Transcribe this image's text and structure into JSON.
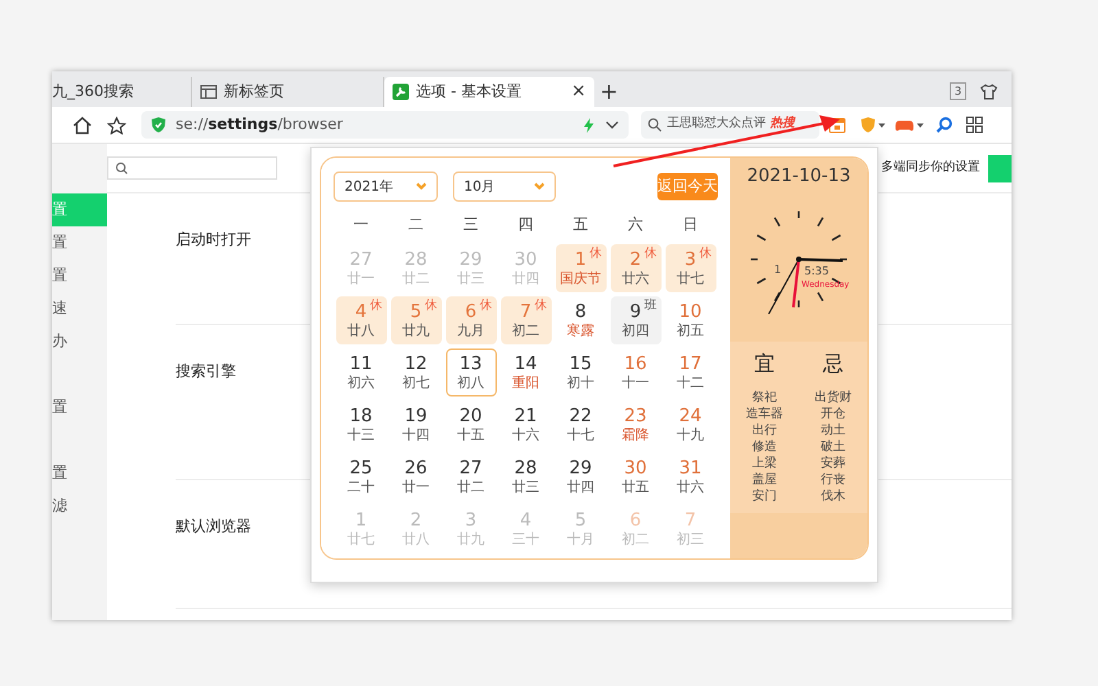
{
  "tabs": [
    {
      "label": "九_360搜索",
      "selected": false
    },
    {
      "label": "新标签页",
      "selected": false
    },
    {
      "label": "选项 - 基本设置",
      "selected": true,
      "close": "×"
    }
  ],
  "new_tab": "+",
  "tab_counter": "3",
  "address_bar": {
    "prefix": "se://",
    "bold": "settings",
    "suffix": "/browser"
  },
  "search_box": {
    "value": "王思聪怼大众点评",
    "hot_label": "热搜"
  },
  "sidebar": {
    "items": [
      {
        "label": "置",
        "selected": true
      },
      {
        "label": "置",
        "selected": false
      },
      {
        "label": "置",
        "selected": false
      },
      {
        "label": "速",
        "selected": false
      },
      {
        "label": "办",
        "selected": false
      },
      {
        "label": "置",
        "selected": false
      },
      {
        "label": "置",
        "selected": false
      },
      {
        "label": "滤",
        "selected": false
      }
    ]
  },
  "sections": [
    {
      "title": "启动时打开"
    },
    {
      "title": "搜索引擎"
    },
    {
      "title": "默认浏览器"
    }
  ],
  "sync_text": "多端同步你的设置",
  "calendar": {
    "year": "2021年",
    "month": "10月",
    "today_button": "返回今天",
    "weekdays": [
      "一",
      "二",
      "三",
      "四",
      "五",
      "六",
      "日"
    ],
    "days": [
      {
        "day": "27",
        "lunar": "廿一",
        "in_month": false,
        "weekend": false,
        "festival": false,
        "selected": false
      },
      {
        "day": "28",
        "lunar": "廿二",
        "in_month": false,
        "weekend": false,
        "festival": false,
        "selected": false
      },
      {
        "day": "29",
        "lunar": "廿三",
        "in_month": false,
        "weekend": false,
        "festival": false,
        "selected": false
      },
      {
        "day": "30",
        "lunar": "廿四",
        "in_month": false,
        "weekend": false,
        "festival": false,
        "selected": false
      },
      {
        "day": "1",
        "lunar": "国庆节",
        "in_month": true,
        "weekend": false,
        "festival": true,
        "selected": false,
        "tag": {
          "text": "休",
          "kind": "rest"
        }
      },
      {
        "day": "2",
        "lunar": "廿六",
        "in_month": true,
        "weekend": true,
        "festival": false,
        "selected": false,
        "tag": {
          "text": "休",
          "kind": "rest"
        }
      },
      {
        "day": "3",
        "lunar": "廿七",
        "in_month": true,
        "weekend": true,
        "festival": false,
        "selected": false,
        "tag": {
          "text": "休",
          "kind": "rest"
        }
      },
      {
        "day": "4",
        "lunar": "廿八",
        "in_month": true,
        "weekend": false,
        "festival": false,
        "selected": false,
        "tag": {
          "text": "休",
          "kind": "rest"
        }
      },
      {
        "day": "5",
        "lunar": "廿九",
        "in_month": true,
        "weekend": false,
        "festival": false,
        "selected": false,
        "tag": {
          "text": "休",
          "kind": "rest"
        }
      },
      {
        "day": "6",
        "lunar": "九月",
        "in_month": true,
        "weekend": false,
        "festival": false,
        "selected": false,
        "tag": {
          "text": "休",
          "kind": "rest"
        }
      },
      {
        "day": "7",
        "lunar": "初二",
        "in_month": true,
        "weekend": false,
        "festival": false,
        "selected": false,
        "tag": {
          "text": "休",
          "kind": "rest"
        }
      },
      {
        "day": "8",
        "lunar": "寒露",
        "in_month": true,
        "weekend": false,
        "festival": true,
        "selected": false
      },
      {
        "day": "9",
        "lunar": "初四",
        "in_month": true,
        "weekend": false,
        "festival": false,
        "selected": false,
        "tag": {
          "text": "班",
          "kind": "work"
        }
      },
      {
        "day": "10",
        "lunar": "初五",
        "in_month": true,
        "weekend": true,
        "festival": false,
        "selected": false
      },
      {
        "day": "11",
        "lunar": "初六",
        "in_month": true,
        "weekend": false,
        "festival": false,
        "selected": false
      },
      {
        "day": "12",
        "lunar": "初七",
        "in_month": true,
        "weekend": false,
        "festival": false,
        "selected": false
      },
      {
        "day": "13",
        "lunar": "初八",
        "in_month": true,
        "weekend": false,
        "festival": false,
        "selected": true
      },
      {
        "day": "14",
        "lunar": "重阳",
        "in_month": true,
        "weekend": false,
        "festival": true,
        "selected": false
      },
      {
        "day": "15",
        "lunar": "初十",
        "in_month": true,
        "weekend": false,
        "festival": false,
        "selected": false
      },
      {
        "day": "16",
        "lunar": "十一",
        "in_month": true,
        "weekend": true,
        "festival": false,
        "selected": false
      },
      {
        "day": "17",
        "lunar": "十二",
        "in_month": true,
        "weekend": true,
        "festival": false,
        "selected": false
      },
      {
        "day": "18",
        "lunar": "十三",
        "in_month": true,
        "weekend": false,
        "festival": false,
        "selected": false
      },
      {
        "day": "19",
        "lunar": "十四",
        "in_month": true,
        "weekend": false,
        "festival": false,
        "selected": false
      },
      {
        "day": "20",
        "lunar": "十五",
        "in_month": true,
        "weekend": false,
        "festival": false,
        "selected": false
      },
      {
        "day": "21",
        "lunar": "十六",
        "in_month": true,
        "weekend": false,
        "festival": false,
        "selected": false
      },
      {
        "day": "22",
        "lunar": "十七",
        "in_month": true,
        "weekend": false,
        "festival": false,
        "selected": false
      },
      {
        "day": "23",
        "lunar": "霜降",
        "in_month": true,
        "weekend": true,
        "festival": true,
        "selected": false
      },
      {
        "day": "24",
        "lunar": "十九",
        "in_month": true,
        "weekend": true,
        "festival": false,
        "selected": false
      },
      {
        "day": "25",
        "lunar": "二十",
        "in_month": true,
        "weekend": false,
        "festival": false,
        "selected": false
      },
      {
        "day": "26",
        "lunar": "廿一",
        "in_month": true,
        "weekend": false,
        "festival": false,
        "selected": false
      },
      {
        "day": "27",
        "lunar": "廿二",
        "in_month": true,
        "weekend": false,
        "festival": false,
        "selected": false
      },
      {
        "day": "28",
        "lunar": "廿三",
        "in_month": true,
        "weekend": false,
        "festival": false,
        "selected": false
      },
      {
        "day": "29",
        "lunar": "廿四",
        "in_month": true,
        "weekend": false,
        "festival": false,
        "selected": false
      },
      {
        "day": "30",
        "lunar": "廿五",
        "in_month": true,
        "weekend": true,
        "festival": false,
        "selected": false
      },
      {
        "day": "31",
        "lunar": "廿六",
        "in_month": true,
        "weekend": true,
        "festival": false,
        "selected": false
      },
      {
        "day": "1",
        "lunar": "廿七",
        "in_month": false,
        "weekend": false,
        "festival": false,
        "selected": false
      },
      {
        "day": "2",
        "lunar": "廿八",
        "in_month": false,
        "weekend": false,
        "festival": false,
        "selected": false
      },
      {
        "day": "3",
        "lunar": "廿九",
        "in_month": false,
        "weekend": false,
        "festival": false,
        "selected": false
      },
      {
        "day": "4",
        "lunar": "三十",
        "in_month": false,
        "weekend": false,
        "festival": false,
        "selected": false
      },
      {
        "day": "5",
        "lunar": "十月",
        "in_month": false,
        "weekend": false,
        "festival": false,
        "selected": false
      },
      {
        "day": "6",
        "lunar": "初二",
        "in_month": false,
        "weekend": true,
        "festival": false,
        "selected": false
      },
      {
        "day": "7",
        "lunar": "初三",
        "in_month": false,
        "weekend": true,
        "festival": false,
        "selected": false
      }
    ],
    "date": "2021-10-13",
    "clock": {
      "time_parts": [
        "1",
        "5:35"
      ],
      "weekday": "Wednesday"
    },
    "yi": {
      "title": "宜",
      "items": [
        "祭祀",
        "造车器",
        "出行",
        "修造",
        "上梁",
        "盖屋",
        "安门"
      ]
    },
    "ji": {
      "title": "忌",
      "items": [
        "出货财",
        "开仓",
        "动土",
        "破土",
        "安葬",
        "行丧",
        "伐木"
      ]
    }
  }
}
